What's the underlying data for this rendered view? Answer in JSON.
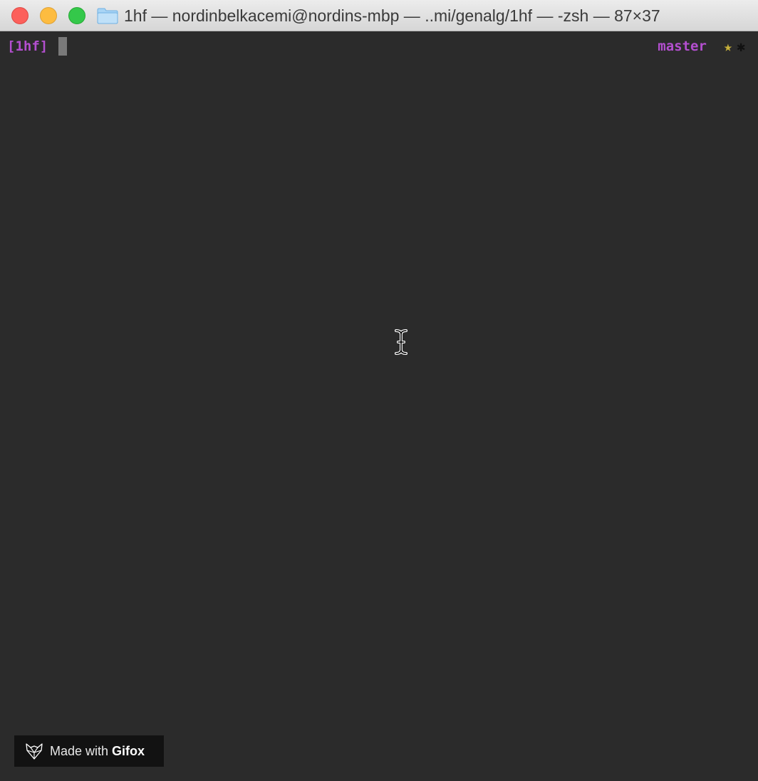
{
  "window": {
    "title": "1hf — nordinbelkacemi@nordins-mbp — ..mi/genalg/1hf — -zsh — 87×37",
    "folder_icon": "folder-icon"
  },
  "terminal": {
    "prompt": "[1hf]",
    "branch": "master",
    "star": "★",
    "dirty_marker": "✱",
    "colors": {
      "background": "#2b2b2b",
      "prompt": "#b44fd0",
      "star": "#c7b03a"
    }
  },
  "watermark": {
    "prefix": "Made with",
    "brand": "Gifox",
    "logo_icon": "fox-logo-icon"
  }
}
